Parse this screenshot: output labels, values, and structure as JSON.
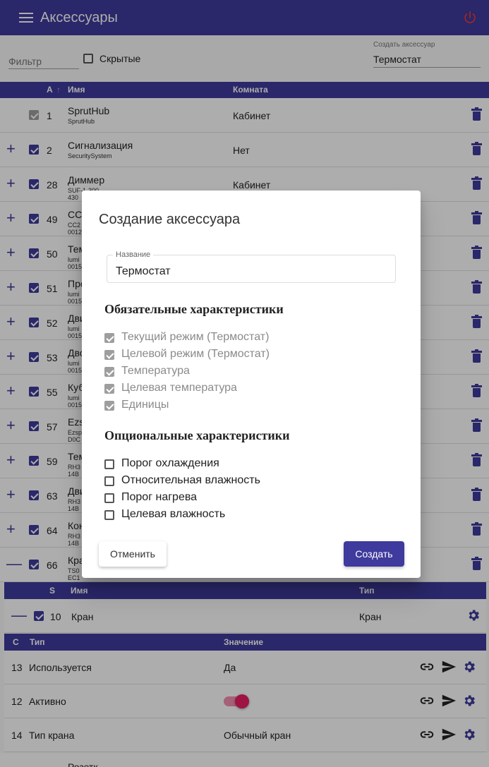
{
  "appbar": {
    "title": "Аксессуары"
  },
  "filterbar": {
    "filter_placeholder": "Фильтр",
    "hidden_label": "Скрытые",
    "create_label": "Создать аксессуар",
    "create_value": "Термостат"
  },
  "table": {
    "headers": {
      "a": "A",
      "name": "Имя",
      "room": "Комната"
    },
    "rows": [
      {
        "num": "1",
        "name": "SprutHub",
        "sub": "SprutHub",
        "sub2": "",
        "room": "Кабинет"
      },
      {
        "num": "2",
        "name": "Сигнализация",
        "sub": "SecuritySystem",
        "sub2": "",
        "room": "Нет"
      },
      {
        "num": "28",
        "name": "Диммер",
        "sub": "SUF-1-300",
        "sub2": "430",
        "room": "Кабинет"
      },
      {
        "num": "49",
        "name": "CC2",
        "sub": "CC2",
        "sub2": "0012",
        "room": ""
      },
      {
        "num": "50",
        "name": "Тем",
        "sub": "lumi",
        "sub2": "0015",
        "room": ""
      },
      {
        "num": "51",
        "name": "Про",
        "sub": "lumi",
        "sub2": "0015",
        "room": ""
      },
      {
        "num": "52",
        "name": "Дви",
        "sub": "lumi",
        "sub2": "0015",
        "room": ""
      },
      {
        "num": "53",
        "name": "Дво",
        "sub": "lumi",
        "sub2": "0015",
        "room": ""
      },
      {
        "num": "55",
        "name": "Куб",
        "sub": "lumi",
        "sub2": "0015",
        "room": ""
      },
      {
        "num": "57",
        "name": "Ezs",
        "sub": "Ezsp",
        "sub2": "D0C",
        "room": ""
      },
      {
        "num": "59",
        "name": "Тем",
        "sub": "RH3",
        "sub2": "14B",
        "room": ""
      },
      {
        "num": "63",
        "name": "Дви",
        "sub": "RH3",
        "sub2": "14B",
        "room": ""
      },
      {
        "num": "64",
        "name": "Кон",
        "sub": "RH3",
        "sub2": "14B",
        "room": ""
      },
      {
        "num": "66",
        "name": "Кра",
        "sub": "TS0",
        "sub2": "EC1",
        "room": ""
      }
    ]
  },
  "services": {
    "headers": {
      "s": "S",
      "name": "Имя",
      "type": "Тип"
    },
    "row": {
      "num": "10",
      "name": "Кран",
      "type": "Кран"
    }
  },
  "characteristics": {
    "headers": {
      "c": "C",
      "type": "Тип",
      "value": "Значение"
    },
    "rows": [
      {
        "num": "13",
        "type": "Используется",
        "value": "Да"
      },
      {
        "num": "12",
        "type": "Активно",
        "value": ""
      },
      {
        "num": "14",
        "type": "Тип крана",
        "value": "Обычный кран"
      }
    ]
  },
  "bottom_row": {
    "name": "Розетк"
  },
  "dialog": {
    "title": "Создание аксессуара",
    "name_label": "Название",
    "name_value": "Термостат",
    "required_title": "Обязательные характеристики",
    "required": [
      "Текущий режим (Термостат)",
      "Целевой режим (Термостат)",
      "Температура",
      "Целевая температура",
      "Единицы"
    ],
    "optional_title": "Опциональные характеристики",
    "optional": [
      "Порог охлаждения",
      "Относительная влажность",
      "Порог нагрева",
      "Целевая влажность"
    ],
    "cancel_label": "Отменить",
    "create_label": "Создать"
  },
  "colors": {
    "primary": "#3f3a9d",
    "power": "#e53935",
    "toggle": "#e91e63"
  }
}
